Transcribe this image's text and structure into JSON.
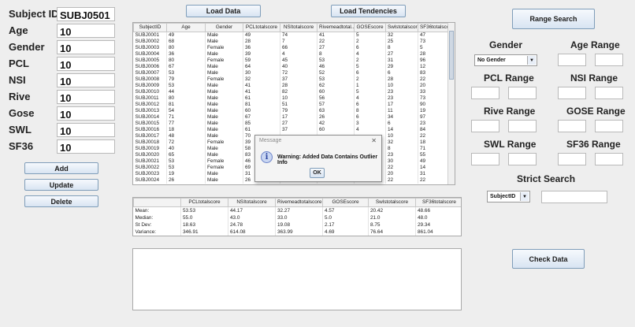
{
  "form": {
    "fields": [
      {
        "label": "Subject ID",
        "value": "SUBJ0501"
      },
      {
        "label": "Age",
        "value": "10"
      },
      {
        "label": "Gender",
        "value": "10"
      },
      {
        "label": "PCL",
        "value": "10"
      },
      {
        "label": "NSI",
        "value": "10"
      },
      {
        "label": "Rive",
        "value": "10"
      },
      {
        "label": "Gose",
        "value": "10"
      },
      {
        "label": "SWL",
        "value": "10"
      },
      {
        "label": "SF36",
        "value": "10"
      }
    ],
    "buttons": {
      "add": "Add",
      "update": "Update",
      "delete": "Delete"
    }
  },
  "top_buttons": {
    "load_data": "Load Data",
    "load_tendencies": "Load Tendencies"
  },
  "grid": {
    "columns": [
      "SubjectID",
      "Age",
      "Gender",
      "PCLtotalscore",
      "NSItotalscore",
      "Rivemeadtotal...",
      "GOSEscore",
      "Swlstotalscore",
      "SF36totalscore"
    ],
    "rows": [
      [
        "SUBJ0001",
        "49",
        "Male",
        "49",
        "74",
        "41",
        "5",
        "32",
        "47"
      ],
      [
        "SUBJ0002",
        "68",
        "Male",
        "28",
        "7",
        "22",
        "2",
        "25",
        "73"
      ],
      [
        "SUBJ0003",
        "80",
        "Female",
        "36",
        "66",
        "27",
        "6",
        "8",
        "5"
      ],
      [
        "SUBJ0004",
        "36",
        "Male",
        "39",
        "4",
        "8",
        "4",
        "27",
        "28"
      ],
      [
        "SUBJ0005",
        "80",
        "Female",
        "59",
        "45",
        "53",
        "2",
        "31",
        "96"
      ],
      [
        "SUBJ0006",
        "67",
        "Male",
        "64",
        "40",
        "46",
        "5",
        "29",
        "12"
      ],
      [
        "SUBJ0007",
        "53",
        "Male",
        "30",
        "72",
        "52",
        "6",
        "6",
        "83"
      ],
      [
        "SUBJ0008",
        "79",
        "Female",
        "32",
        "37",
        "53",
        "2",
        "28",
        "22"
      ],
      [
        "SUBJ0009",
        "53",
        "Male",
        "41",
        "28",
        "62",
        "1",
        "10",
        "20"
      ],
      [
        "SUBJ0010",
        "44",
        "Male",
        "41",
        "82",
        "60",
        "5",
        "23",
        "33"
      ],
      [
        "SUBJ0011",
        "80",
        "Male",
        "61",
        "10",
        "56",
        "4",
        "23",
        "73"
      ],
      [
        "SUBJ0012",
        "81",
        "Male",
        "81",
        "51",
        "57",
        "6",
        "17",
        "90"
      ],
      [
        "SUBJ0013",
        "54",
        "Male",
        "60",
        "79",
        "63",
        "8",
        "11",
        "19"
      ],
      [
        "SUBJ0014",
        "71",
        "Male",
        "67",
        "17",
        "26",
        "6",
        "34",
        "97"
      ],
      [
        "SUBJ0015",
        "77",
        "Male",
        "85",
        "27",
        "42",
        "3",
        "6",
        "23"
      ],
      [
        "SUBJ0016",
        "18",
        "Male",
        "61",
        "37",
        "60",
        "4",
        "14",
        "84"
      ],
      [
        "SUBJ0017",
        "48",
        "Male",
        "70",
        "",
        "",
        "",
        "10",
        "22"
      ],
      [
        "SUBJ0018",
        "72",
        "Female",
        "39",
        "",
        "",
        "",
        "32",
        "18"
      ],
      [
        "SUBJ0019",
        "40",
        "Male",
        "58",
        "",
        "",
        "",
        "8",
        "71"
      ],
      [
        "SUBJ0020",
        "65",
        "Male",
        "83",
        "",
        "",
        "",
        "23",
        "55"
      ],
      [
        "SUBJ0021",
        "53",
        "Female",
        "46",
        "",
        "",
        "",
        "30",
        "49"
      ],
      [
        "SUBJ0022",
        "53",
        "Female",
        "69",
        "",
        "",
        "",
        "22",
        "14"
      ],
      [
        "SUBJ0023",
        "19",
        "Male",
        "31",
        "",
        "",
        "",
        "20",
        "31"
      ],
      [
        "SUBJ0024",
        "26",
        "Male",
        "26",
        "",
        "",
        "",
        "22",
        "22"
      ]
    ]
  },
  "stats": {
    "columns": [
      "",
      "PCLtotalscore",
      "NSItotalscore",
      "Rivemeadtotalscore",
      "GOSEscore",
      "Swlstotalscore",
      "SF36totalscore"
    ],
    "rows": [
      [
        "Mean:",
        "53.53",
        "44.17",
        "32.27",
        "4.57",
        "20.42",
        "48.66"
      ],
      [
        "Median:",
        "55.0",
        "43.0",
        "33.0",
        "5.0",
        "21.0",
        "48.0"
      ],
      [
        "St Dev:",
        "18.63",
        "24.78",
        "19.08",
        "2.17",
        "8.75",
        "29.34"
      ],
      [
        "Variance:",
        "346.91",
        "614.08",
        "363.99",
        "4.69",
        "76.64",
        "861.04"
      ]
    ]
  },
  "right": {
    "range_search": "Range Search",
    "gender_label": "Gender",
    "gender_value": "No Gender",
    "age_range": "Age Range",
    "pcl_range": "PCL Range",
    "nsi_range": "NSI Range",
    "rive_range": "Rive Range",
    "gose_range": "GOSE Range",
    "swl_range": "SWL Range",
    "sf36_range": "SF36 Range",
    "strict_search": "Strict Search",
    "strict_field": "SubjectID",
    "check_data": "Check Data"
  },
  "dialog": {
    "title": "Message",
    "message": "Warning: Added Data Contains Outlier Info",
    "ok": "OK"
  }
}
